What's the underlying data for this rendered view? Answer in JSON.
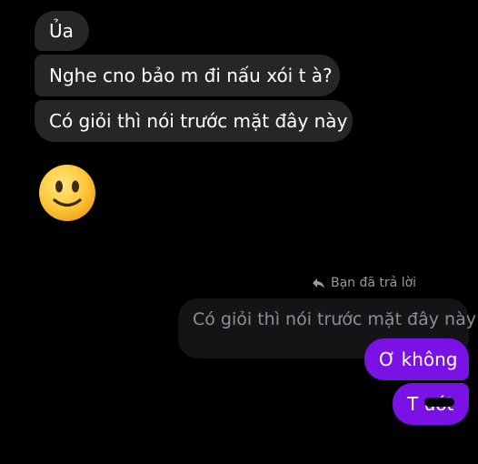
{
  "incoming_messages": [
    {
      "text": "Ủa"
    },
    {
      "text": "Nghe cno bảo m đi nấu xói t à?"
    },
    {
      "text": "Có giỏi thì nói trước mặt đây này"
    }
  ],
  "emoji_reaction": {
    "icon": "slightly-smiling-face-icon"
  },
  "reply": {
    "label": "Bạn đã trả lời",
    "quoted_text": "Có giỏi thì nói trước mặt đây này"
  },
  "outgoing_messages": [
    {
      "text": "Ơ không"
    },
    {
      "text": "T ướt"
    }
  ],
  "colors": {
    "background": "#000000",
    "incoming_bubble": "#262628",
    "quoted_bubble": "#141416",
    "outgoing_bubble": "#7a12e6",
    "secondary_text": "#9a9a9e"
  }
}
